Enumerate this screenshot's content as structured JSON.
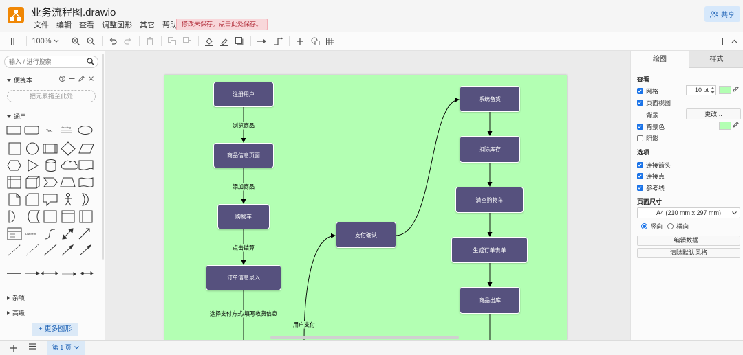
{
  "header": {
    "file_title": "业务流程图.drawio",
    "menu": [
      "文件",
      "编辑",
      "查看",
      "调整图形",
      "其它",
      "帮助"
    ],
    "save_warning": "修改未保存。点击此处保存。",
    "share_label": "共享"
  },
  "toolbar": {
    "zoom": "100%"
  },
  "left_panel": {
    "search_placeholder": "输入 / 进行搜索",
    "scratchpad_title": "便笺本",
    "scratchpad_drop": "把元素拖至此处",
    "general_title": "通用",
    "misc_title": "杂项",
    "advanced_title": "高级",
    "more_shapes_label": "更多图形",
    "shape_text_label": "Text",
    "shape_heading_label": "Heading",
    "shape_list_label": "List Item"
  },
  "diagram": {
    "nodes": {
      "register": "注册用户",
      "product_page": "商品信息页面",
      "cart": "购物车",
      "order_entry": "订单信息录入",
      "pay_confirm": "支付确认",
      "system_stock": "系统备货",
      "deduct_stock": "扣除库存",
      "clear_cart": "清空购物车",
      "create_order": "生成订单表单",
      "ship": "商品出库"
    },
    "edge_labels": {
      "browse": "浏览商品",
      "add": "添加商品",
      "checkout": "点击结算",
      "choose_pay": "选择支付方式/填写收货信息",
      "user_pay": "用户支付"
    }
  },
  "right_panel": {
    "tab_draw": "绘图",
    "tab_style": "样式",
    "view_heading": "查看",
    "grid_label": "网格",
    "grid_size": "10 pt",
    "page_view_label": "页面视图",
    "background_label": "背景",
    "change_label": "更改...",
    "bg_color_label": "背景色",
    "shadow_label": "阴影",
    "options_heading": "选项",
    "connection_arrows_label": "连接箭头",
    "connection_points_label": "连接点",
    "guides_label": "参考线",
    "paper_size_heading": "页面尺寸",
    "paper_size_value": "A4 (210 mm x 297 mm)",
    "portrait_label": "竖向",
    "landscape_label": "横向",
    "edit_data_label": "编辑数据...",
    "clear_style_label": "清除默认风格",
    "background_color": "#b3ffb3"
  },
  "bottom_bar": {
    "page_tab_label": "第 1 页"
  },
  "colors": {
    "node_fill": "#56517e",
    "page_background": "#b3ffb3",
    "accent": "#1a73e8",
    "logo": "#f08705"
  }
}
